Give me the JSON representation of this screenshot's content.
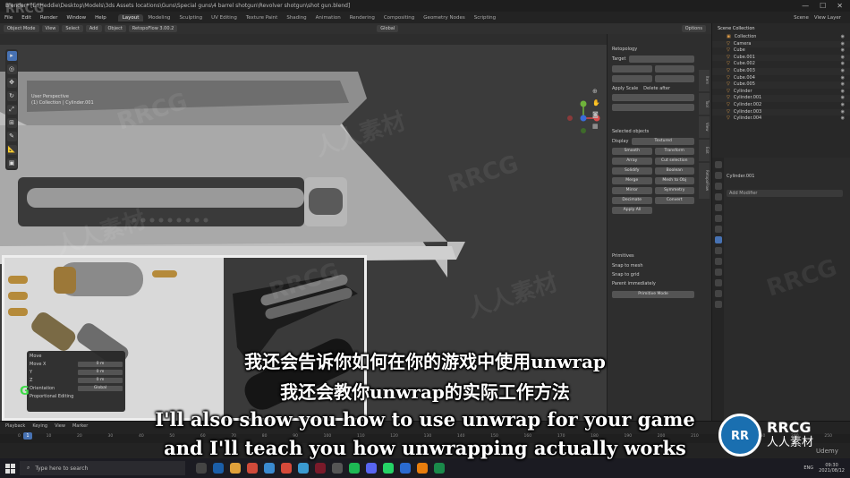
{
  "window": {
    "title": "Blender* [E:\\Heddie\\Desktop\\Models\\3ds Assets locations\\Guns\\Special guns\\4 barrel shotgun\\Revolver shotgun\\shot gun.blend]",
    "minimize": "—",
    "maximize": "☐",
    "close": "✕"
  },
  "menu": {
    "items": [
      "File",
      "Edit",
      "Render",
      "Window",
      "Help"
    ],
    "workspaces": [
      "Layout",
      "Modeling",
      "Sculpting",
      "UV Editing",
      "Texture Paint",
      "Shading",
      "Animation",
      "Rendering",
      "Compositing",
      "Geometry Nodes",
      "Scripting"
    ],
    "active_workspace": "Layout",
    "scene_label": "Scene",
    "view_layer_label": "View Layer"
  },
  "viewport_header": {
    "mode": "Object Mode",
    "view": "View",
    "select": "Select",
    "add": "Add",
    "object": "Object",
    "extra": "RetopoFlow 3.00.2",
    "transform": "Global",
    "options": "Options"
  },
  "viewport": {
    "info_line1": "User Perspective",
    "info_line2": "(1) Collection | Cylinder.001"
  },
  "redo_panel": {
    "title": "Move",
    "fields": [
      {
        "label": "Move X",
        "value": "0 m"
      },
      {
        "label": "Y",
        "value": "0 m"
      },
      {
        "label": "Z",
        "value": "0 m"
      }
    ],
    "orientation_label": "Orientation",
    "orientation_value": "Global",
    "proportional": "Proportional Editing"
  },
  "key_overlay": "G",
  "npanel": {
    "tabs": [
      "Item",
      "Tool",
      "View",
      "Edit",
      "RetopoFlow"
    ],
    "section1_title": "Retopology",
    "target_label": "Target",
    "apply_label": "Apply Scale",
    "delete_label": "Delete after",
    "section2_title": "Selected objects",
    "display_label": "Display",
    "display_value": "Textured",
    "buttons": [
      "Smooth",
      "Transform",
      "Array",
      "Cut selection",
      "Solidify",
      "Boolean",
      "Merge",
      "Mesh to Obj",
      "Mirror",
      "Symmetry",
      "Decimate",
      "Convert",
      "Apply All"
    ],
    "section3_title": "Primitives",
    "snap_label": "Snap to mesh",
    "grid_label": "Snap to grid",
    "parent_label": "Parent immediately",
    "primitive_button": "Primitive Mode"
  },
  "outliner": {
    "header": "Scene Collection",
    "rows": [
      "Collection",
      "Camera",
      "Cube",
      "Cube.001",
      "Cube.002",
      "Cube.003",
      "Cube.004",
      "Cube.005",
      "Cylinder",
      "Cylinder.001",
      "Cylinder.002",
      "Cylinder.003",
      "Cylinder.004"
    ]
  },
  "properties": {
    "object_name": "Cylinder.001",
    "add_modifier": "Add Modifier"
  },
  "timeline": {
    "menus": [
      "Playback",
      "Keying",
      "View",
      "Marker"
    ],
    "ticks": [
      "0",
      "10",
      "20",
      "30",
      "40",
      "50",
      "60",
      "70",
      "80",
      "90",
      "100",
      "110",
      "120",
      "130",
      "140",
      "150",
      "160",
      "170",
      "180",
      "190",
      "200",
      "210",
      "220",
      "230",
      "240",
      "250"
    ],
    "current_frame": "1"
  },
  "taskbar": {
    "search_placeholder": "Type here to search",
    "lang": "ENG",
    "time": "09:30",
    "date": "2021/08/12"
  },
  "subtitles": {
    "zh1": "我还会告诉你如何在你的游戏中使用unwrap",
    "zh2": "我还会教你unwrap的实际工作方法",
    "en1": "I'll also show you how to use unwrap for your game",
    "en2": "and I'll teach you how unwrapping actually works"
  },
  "watermark": {
    "corner": "RRCG",
    "brand_en": "RRCG",
    "brand_zh": "人人素材",
    "tiles": [
      "RRCG",
      "人人素材"
    ],
    "udemy": "Udemy"
  },
  "colors": {
    "accent": "#4772b3",
    "key_green": "#3ddc47",
    "object_orange": "#e8a24a"
  }
}
